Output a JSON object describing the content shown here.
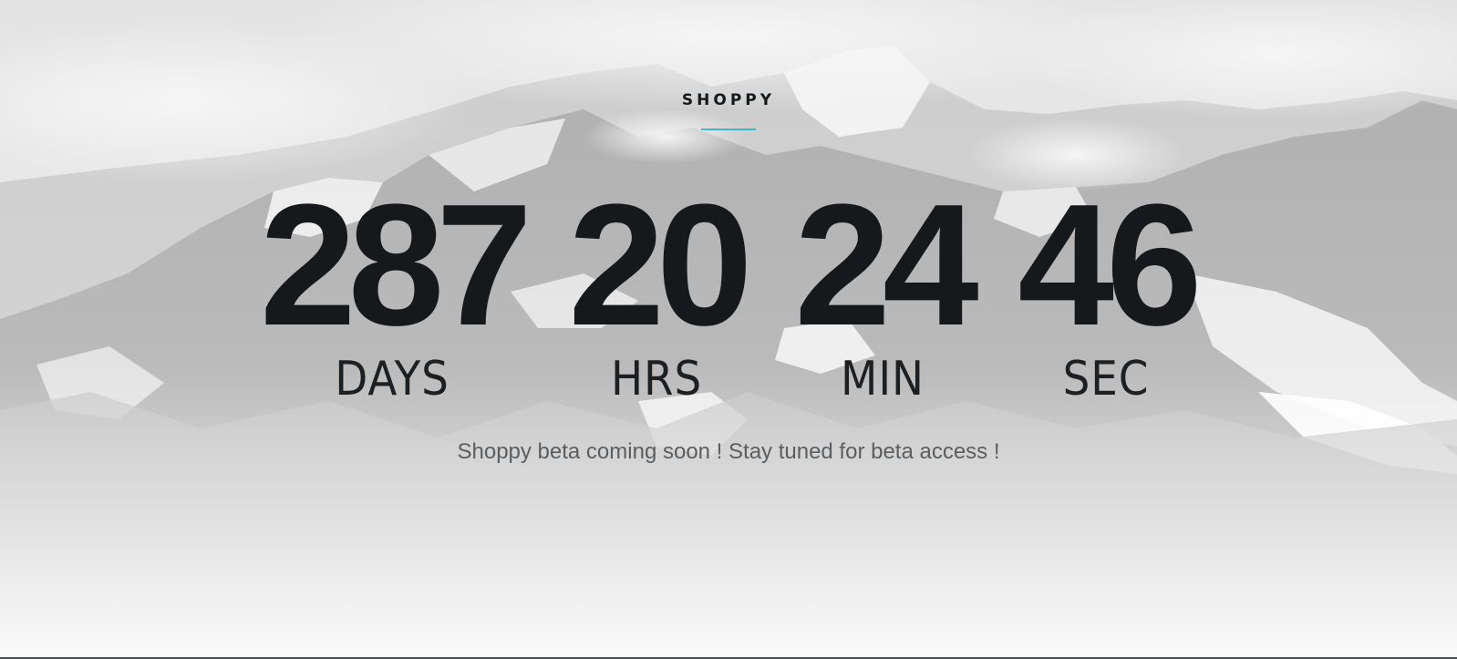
{
  "brand": {
    "name": "SHOPPY"
  },
  "countdown": {
    "days": {
      "value": "287",
      "label": "DAYS"
    },
    "hours": {
      "value": "20",
      "label": "HRS"
    },
    "minutes": {
      "value": "24",
      "label": "MIN"
    },
    "seconds": {
      "value": "46",
      "label": "SEC"
    }
  },
  "tagline": "Shoppy beta coming soon ! Stay tuned for beta access !",
  "colors": {
    "accent": "#3fb8c8",
    "text_dark": "#16191b",
    "text_muted": "#5b5e60"
  },
  "background": {
    "icon": "mountain-landscape"
  }
}
